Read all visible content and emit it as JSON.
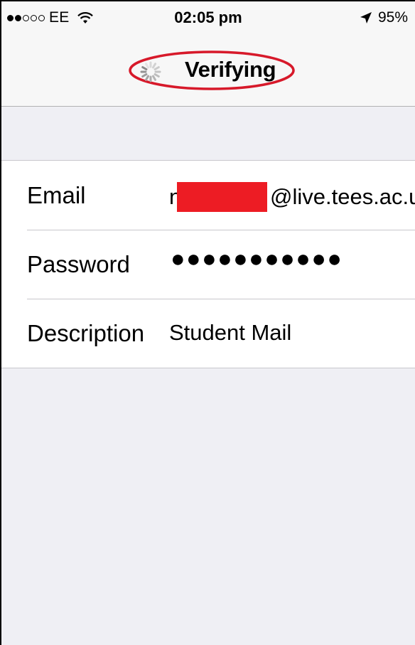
{
  "status_bar": {
    "carrier": "EE",
    "signal_bars_filled": 2,
    "signal_bars_total": 5,
    "time": "02:05 pm",
    "battery": "95%",
    "icons": [
      "signal-dots-icon",
      "wifi-icon",
      "location-arrow-icon"
    ]
  },
  "nav": {
    "title": "Verifying",
    "activity_indicator": "spinner-icon",
    "highlight_color": "#d7192a"
  },
  "form": {
    "email": {
      "label": "Email",
      "value_prefix": "n",
      "value_suffix": "@live.tees.ac.u",
      "redaction_color": "#ed1c24"
    },
    "password": {
      "label": "Password",
      "value": "●●●●●●●●●●●"
    },
    "description": {
      "label": "Description",
      "value": "Student Mail"
    }
  }
}
